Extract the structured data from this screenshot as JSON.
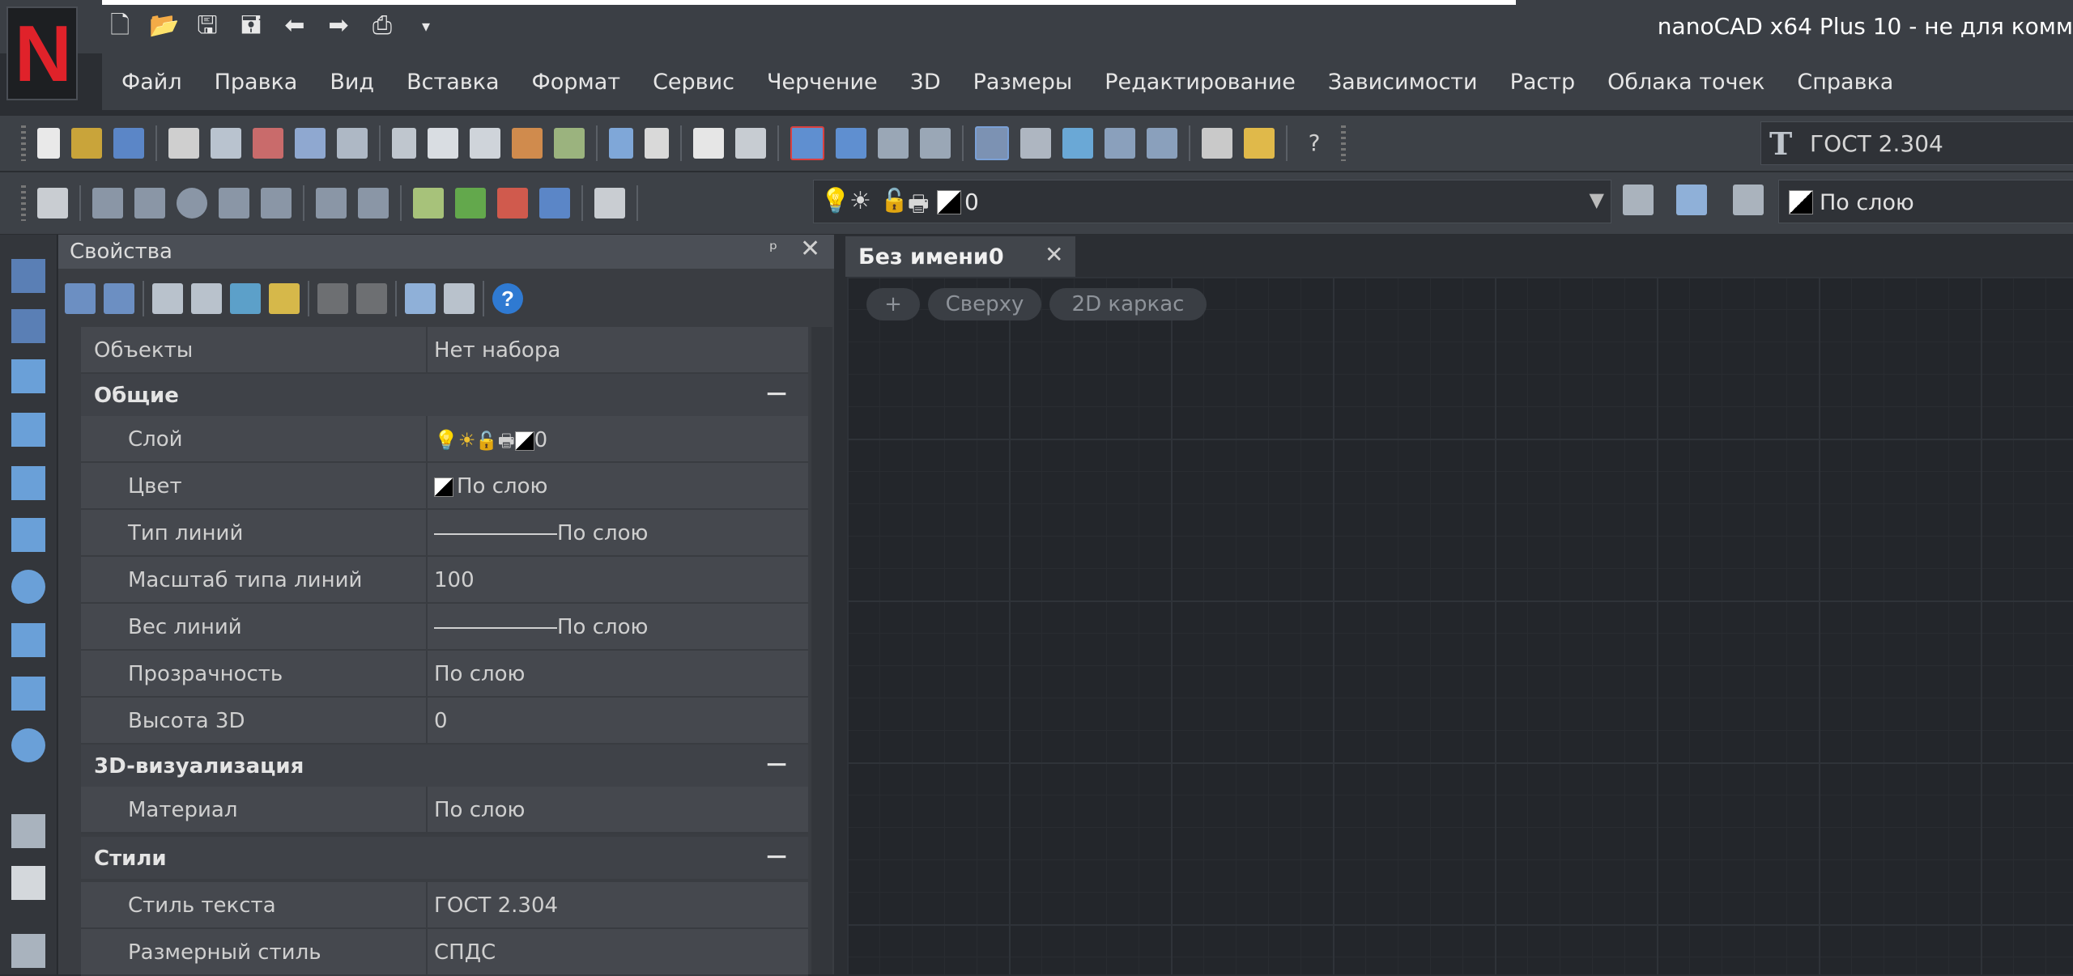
{
  "app": {
    "logo_letter": "N",
    "title": "nanoCAD x64 Plus 10 - не для комм",
    "quick_access_icons": [
      "new-icon",
      "open-icon",
      "save-icon",
      "save-as-icon",
      "undo-icon",
      "redo-icon",
      "print-icon",
      "customize-arrow-icon"
    ]
  },
  "menu": [
    "Файл",
    "Правка",
    "Вид",
    "Вставка",
    "Формат",
    "Сервис",
    "Черчение",
    "3D",
    "Размеры",
    "Редактирование",
    "Зависимости",
    "Растр",
    "Облака точек",
    "Справка"
  ],
  "toolbar1": {
    "text_style": "ГОСТ 2.304",
    "help_label": "?"
  },
  "toolbar2": {
    "layer_name": "0",
    "color_value": "По слою"
  },
  "properties": {
    "title": "Свойства",
    "help_label": "?",
    "objects_label": "Объекты",
    "objects_value": "Нет набора",
    "sections": [
      {
        "name": "Общие",
        "rows": [
          {
            "label": "Слой",
            "value": "0"
          },
          {
            "label": "Цвет",
            "value": "По слою"
          },
          {
            "label": "Тип линий",
            "value": "По слою"
          },
          {
            "label": "Масштаб типа линий",
            "value": "100"
          },
          {
            "label": "Вес линий",
            "value": "По слою"
          },
          {
            "label": "Прозрачность",
            "value": "По слою"
          },
          {
            "label": "Высота 3D",
            "value": "0"
          }
        ]
      },
      {
        "name": "3D-визуализация",
        "rows": [
          {
            "label": "Материал",
            "value": "По слою"
          }
        ]
      },
      {
        "name": "Стили",
        "rows": [
          {
            "label": "Стиль текста",
            "value": "ГОСТ 2.304"
          },
          {
            "label": "Размерный стиль",
            "value": "СПДС"
          }
        ]
      }
    ]
  },
  "document": {
    "tab_title": "Без имени0",
    "viewport_controls": [
      "+",
      "Сверху",
      "2D каркас"
    ]
  },
  "colors": {
    "accent_red": "#e0222a",
    "background": "#23262b",
    "panel": "#45484e"
  }
}
